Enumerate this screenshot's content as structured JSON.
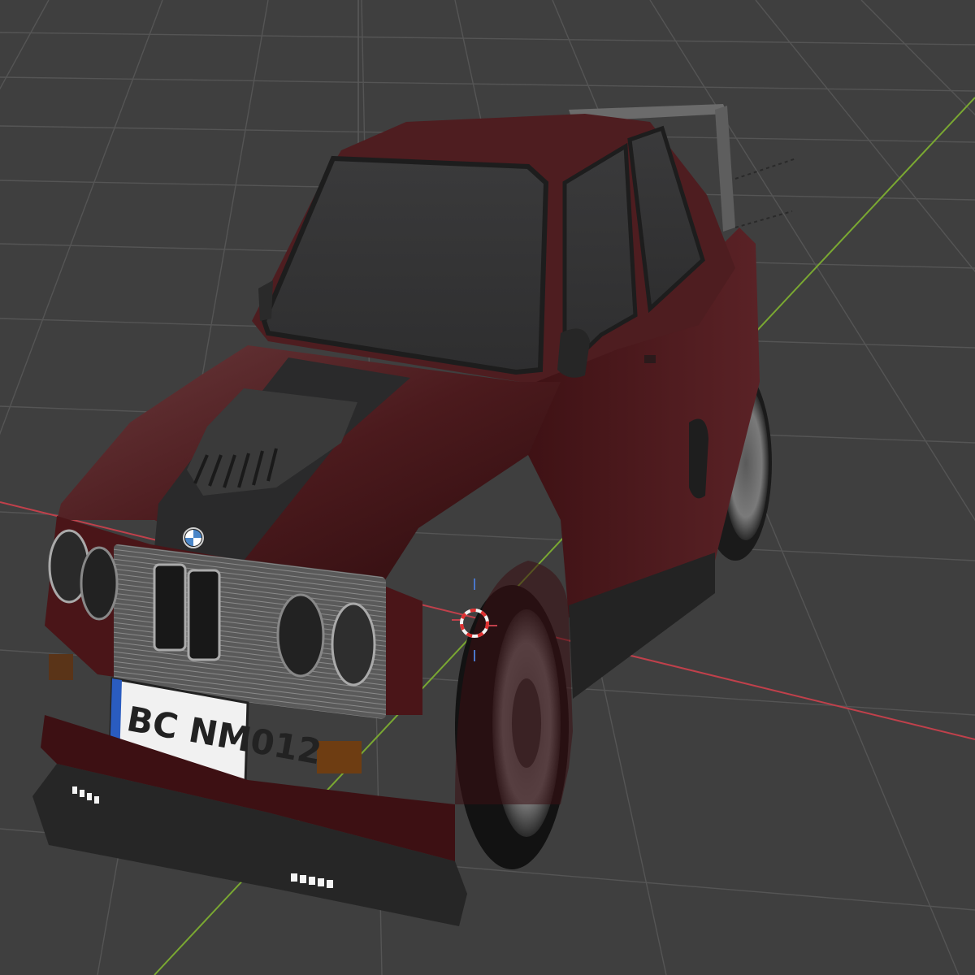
{
  "viewport": {
    "background_color": "#3f3f3f",
    "grid_color": "#555555",
    "x_axis_color": "#c0404b",
    "y_axis_color": "#7aa832",
    "z_axis_color": "#4a76c9"
  },
  "car": {
    "body_color": "#4a1619",
    "license_plate": "BC NM012",
    "badge_icon": "bmw-roundel-icon"
  },
  "cursor_3d": {
    "icon": "3d-cursor-icon",
    "colors": [
      "#e03030",
      "#f2f2f2"
    ]
  }
}
